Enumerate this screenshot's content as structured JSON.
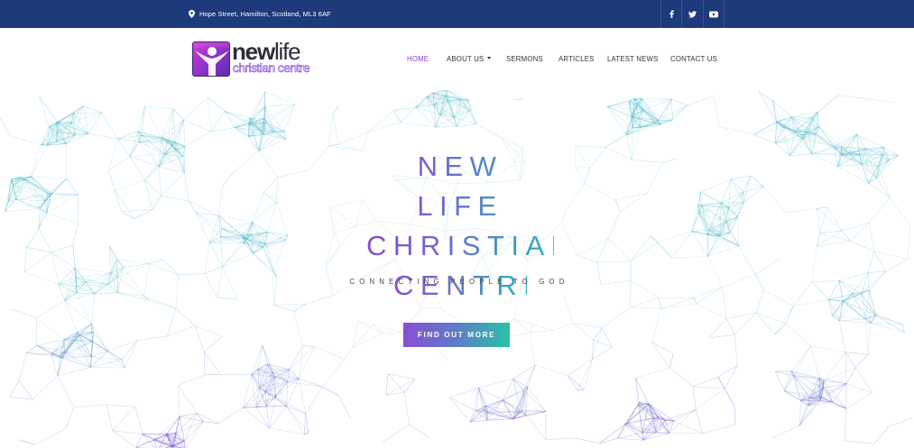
{
  "topbar": {
    "address": "Hope Street, Hamilton, Scotland, ML3 6AF",
    "icons": {
      "location": "map-pin-icon",
      "facebook": "facebook-icon",
      "twitter": "twitter-icon",
      "youtube": "youtube-icon"
    }
  },
  "logo": {
    "line1_bold": "new",
    "line1_light": "life",
    "line2": "christian centre"
  },
  "nav": {
    "items": [
      {
        "label": "HOME",
        "active": true
      },
      {
        "label": "ABOUT US",
        "dropdown": true
      },
      {
        "label": "SERMONS"
      },
      {
        "label": "ARTICLES"
      },
      {
        "label": "LATEST NEWS"
      },
      {
        "label": "CONTACT US"
      }
    ]
  },
  "hero": {
    "title_lines": [
      "NEW LIFE",
      "CHRISTIAN",
      "CENTRE"
    ],
    "tagline": "CONNECTING PEOPLE TO GOD",
    "cta_label": "FIND OUT MORE"
  },
  "colors": {
    "topbar_bg": "#1e3a7b",
    "nav_active": "#8a3fd1",
    "gradient_start": "#8a4ed4",
    "gradient_end": "#2ac2a6"
  }
}
